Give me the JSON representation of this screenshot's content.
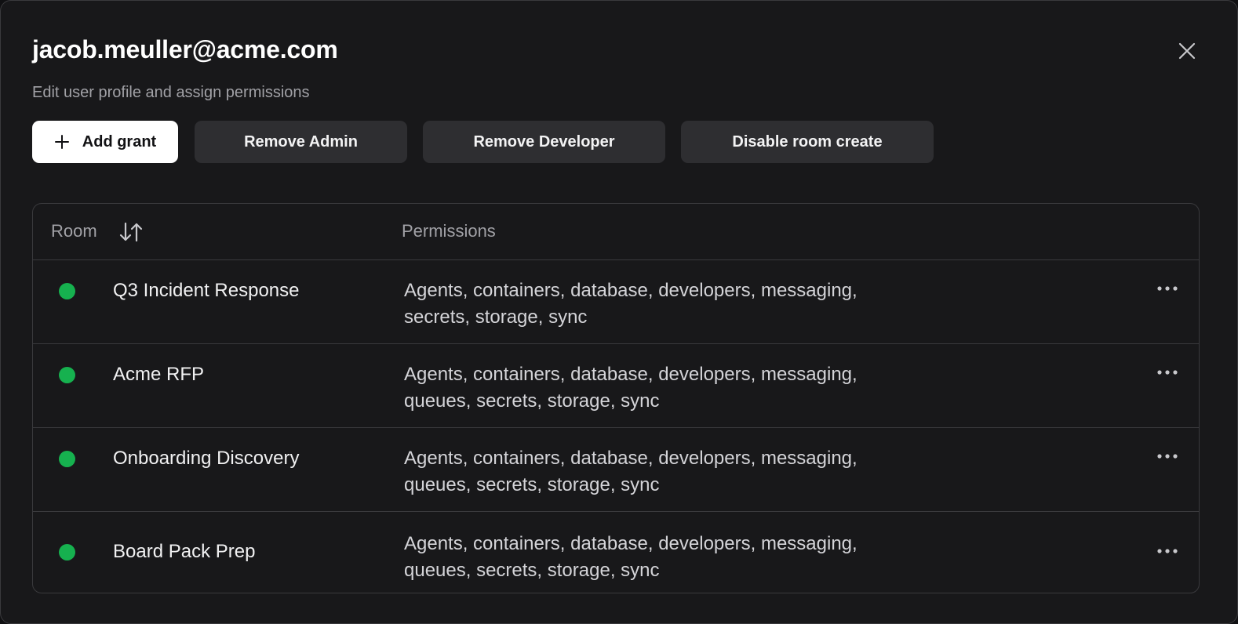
{
  "dialog": {
    "title": "jacob.meuller@acme.com",
    "subtitle": "Edit user profile and assign permissions",
    "close_icon": "close-icon"
  },
  "actions": {
    "add_grant": "Add grant",
    "remove_admin": "Remove Admin",
    "remove_developer": "Remove Developer",
    "disable_room_create": "Disable room create"
  },
  "table": {
    "headers": {
      "room": "Room",
      "permissions": "Permissions"
    },
    "sort_icon": "sort-arrows-icon",
    "rows": [
      {
        "room": "Q3 Incident Response",
        "permissions": "Agents, containers, database, developers, messaging, secrets, storage, sync",
        "status": "active"
      },
      {
        "room": "Acme RFP",
        "permissions": "Agents, containers, database, developers, messaging, queues, secrets, storage, sync",
        "status": "active"
      },
      {
        "room": "Onboarding Discovery",
        "permissions": "Agents, containers, database, developers, messaging, queues, secrets, storage, sync",
        "status": "active"
      },
      {
        "room": "Board Pack Prep",
        "permissions": "Agents, containers, database, developers, messaging, queues, secrets, storage, sync",
        "status": "active"
      }
    ]
  },
  "colors": {
    "status_active": "#16b14f",
    "background": "#18181a",
    "primary_button": "#ffffff",
    "secondary_button": "#2e2e31"
  }
}
